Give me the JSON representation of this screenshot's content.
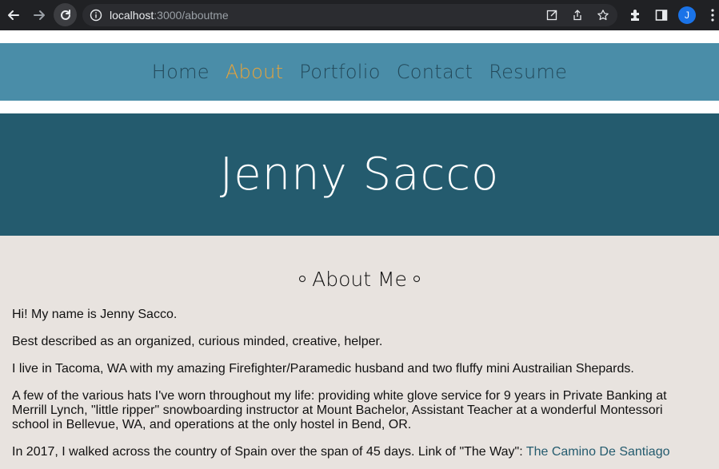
{
  "browser": {
    "url_host": "localhost",
    "url_path": ":3000/aboutme",
    "profile_initial": "J"
  },
  "nav": {
    "items": [
      {
        "label": "Home",
        "active": false
      },
      {
        "label": "About",
        "active": true
      },
      {
        "label": "Portfolio",
        "active": false
      },
      {
        "label": "Contact",
        "active": false
      },
      {
        "label": "Resume",
        "active": false
      }
    ]
  },
  "hero": {
    "name": "Jenny Sacco"
  },
  "about": {
    "title": "About Me",
    "paragraphs": [
      "Hi! My name is Jenny Sacco.",
      "Best described as an organized, curious minded, creative, helper.",
      "I live in Tacoma, WA with my amazing Firefighter/Paramedic husband and two fluffy mini Austrailian Shepards.",
      "A few of the various hats I've worn throughout my life: providing white glove service for 9 years in Private Banking at Merrill Lynch, \"little ripper\" snowboarding instructor at Mount Bachelor, Assistant Teacher at a wonderful Montessori school in Bellevue, WA, and operations at the only hostel in Bend, OR."
    ],
    "last_paragraph_text": "In 2017, I walked across the country of Spain over the span of 45 days. Link of \"The Way\": ",
    "last_paragraph_link": "The Camino De Santiago"
  },
  "colors": {
    "navbar_bg": "#4a8da8",
    "nav_text": "#23495a",
    "nav_active": "#e8a33a",
    "hero_bg": "#245b6e",
    "content_bg": "#e8e3df"
  }
}
